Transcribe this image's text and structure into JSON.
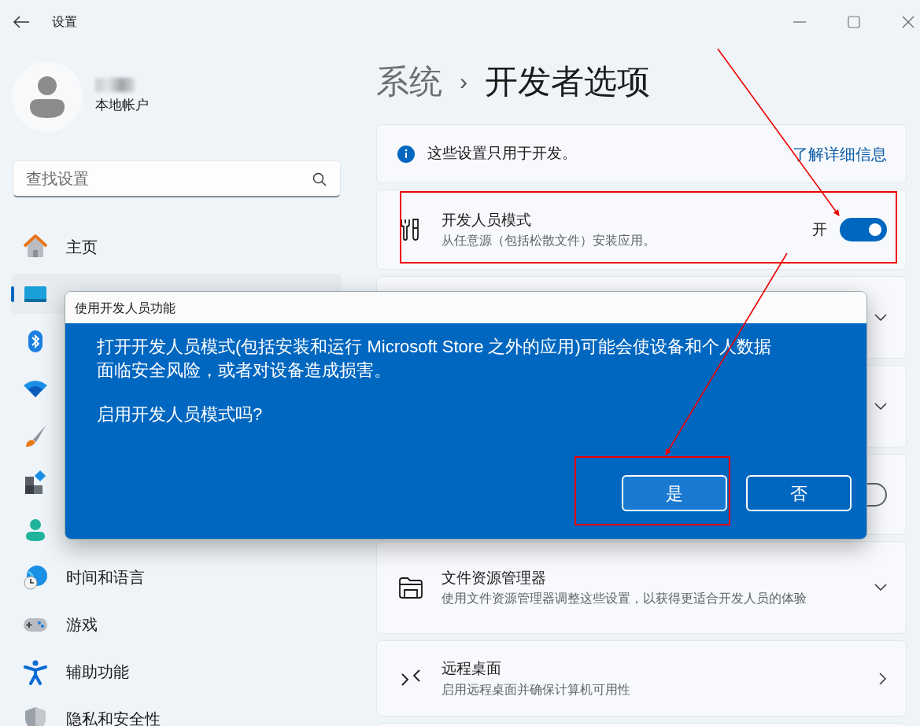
{
  "window": {
    "title": "设置"
  },
  "account": {
    "type": "本地帐户"
  },
  "search": {
    "placeholder": "查找设置"
  },
  "sidebar": {
    "items": [
      {
        "label": "主页",
        "selected": false
      },
      {
        "selected": true
      },
      {
        "selected": false
      },
      {
        "selected": false
      },
      {
        "selected": false
      },
      {
        "selected": false
      },
      {
        "selected": false
      },
      {
        "label": "时间和语言",
        "selected": false
      },
      {
        "label": "游戏",
        "selected": false
      },
      {
        "label": "辅助功能",
        "selected": false
      },
      {
        "label": "隐私和安全性",
        "selected": false
      }
    ]
  },
  "breadcrumb": {
    "parent": "系统",
    "separator": "›",
    "current": "开发者选项"
  },
  "info": {
    "text": "这些设置只用于开发。",
    "link": "了解详细信息"
  },
  "settings": [
    {
      "kind": "toggle",
      "title": "开发人员模式",
      "description": "从任意源（包括松散文件）安装应用。",
      "state_label": "开",
      "on": true
    },
    {
      "kind": "expander"
    },
    {
      "kind": "expander"
    },
    {
      "kind": "toggle",
      "on": false
    },
    {
      "kind": "expander",
      "title": "文件资源管理器",
      "description": "使用文件资源管理器调整这些设置，以获得更适合开发人员的体验"
    },
    {
      "kind": "link",
      "title": "远程桌面",
      "description": "启用远程桌面并确保计算机可用性"
    },
    {
      "kind": "more"
    }
  ],
  "dialog": {
    "title": "使用开发人员功能",
    "message": "打开开发人员模式(包括安装和运行 Microsoft Store 之外的应用)可能会使设备和个人数据面临安全风险，或者对设备造成损害。",
    "question": "启用开发人员模式吗?",
    "buttons": [
      {
        "label": "是",
        "default": true
      },
      {
        "label": "否",
        "default": false
      }
    ]
  }
}
